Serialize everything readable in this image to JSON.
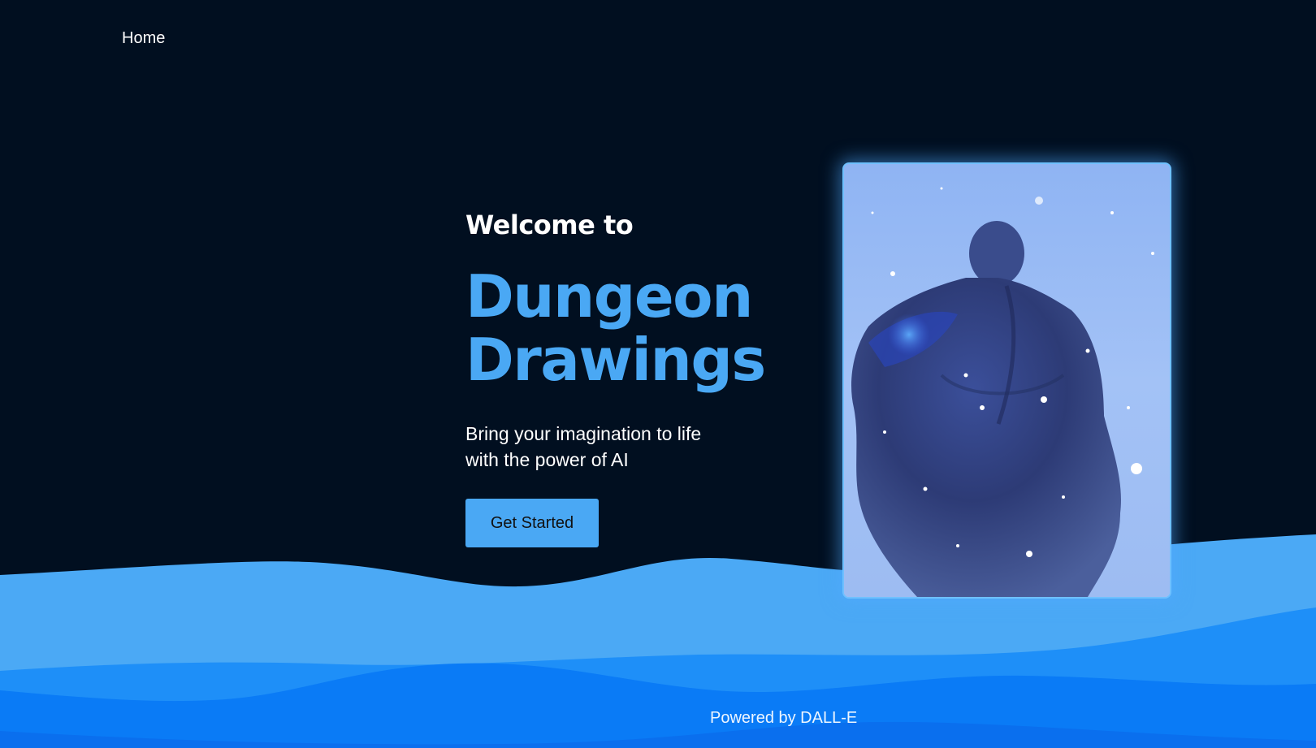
{
  "nav": {
    "items": [
      {
        "label": "Home"
      }
    ]
  },
  "hero": {
    "welcome": "Welcome to",
    "title_line1": "Dungeon",
    "title_line2": "Drawings",
    "tagline": "Bring your imagination to life with the power of AI",
    "cta_label": "Get Started",
    "image": {
      "icon": "ai-generated-artwork"
    }
  },
  "footer": {
    "powered_by": "Powered by DALL-E"
  },
  "colors": {
    "background": "#010f20",
    "accent": "#4aa8f4",
    "wave_light": "#4ba9f5",
    "wave_mid": "#1e8ff8",
    "wave_dark": "#0a78f5"
  }
}
